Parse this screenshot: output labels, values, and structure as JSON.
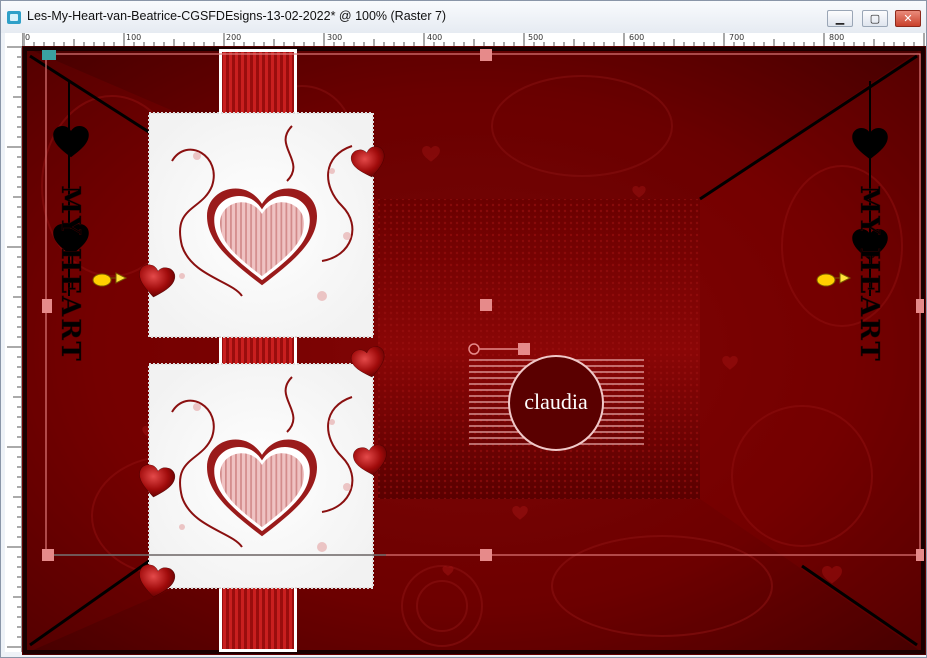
{
  "window": {
    "title": "Les-My-Heart-van-Beatrice-CGSFDEsigns-13-02-2022* @ 100% (Raster 7)",
    "minimize_glyph": "▁",
    "maximize_glyph": "▢",
    "close_glyph": "✕"
  },
  "ruler": {
    "top_labels": [
      "0",
      "100",
      "200",
      "300",
      "400",
      "500",
      "600",
      "700",
      "800"
    ]
  },
  "canvas": {
    "left_text": "MY HEART",
    "right_text": "MY HEART",
    "watermark_text": "claudia",
    "colors": {
      "background": "#7a0000",
      "deep_red": "#4a0000",
      "selection": "#e07a7a",
      "frame_white": "#ffffff"
    }
  },
  "icons": {
    "pointer_hand_left": "pointing-hand-icon",
    "pointer_hand_right": "pointing-hand-icon",
    "heart": "heart-icon"
  }
}
